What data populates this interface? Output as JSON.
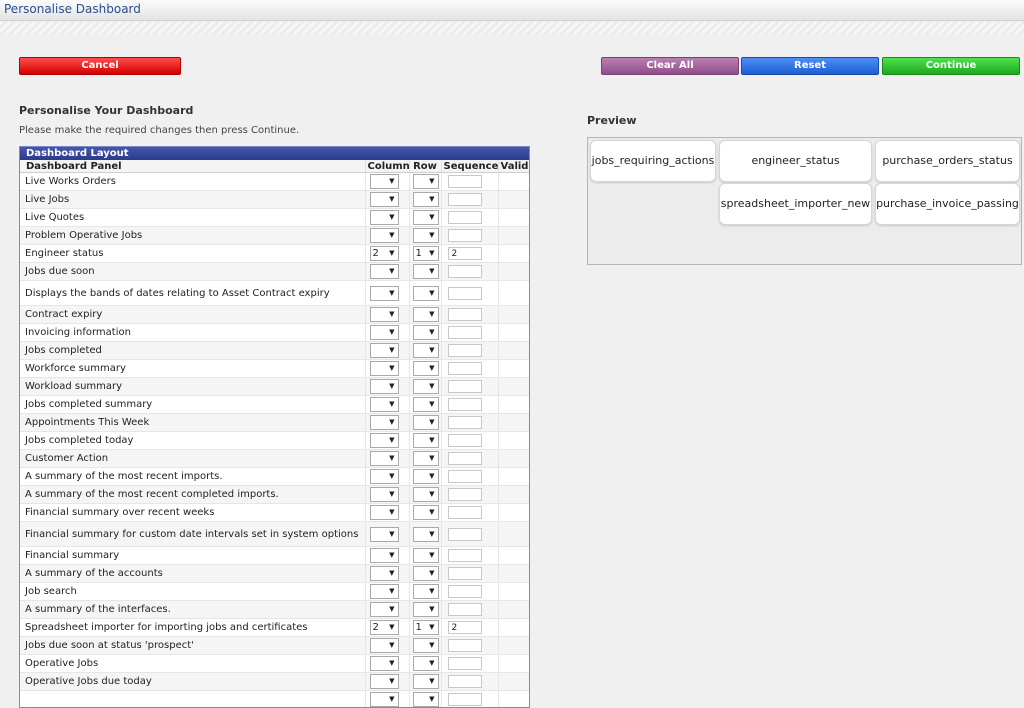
{
  "window": {
    "title": "Personalise Dashboard"
  },
  "toolbar": {
    "cancel_label": "Cancel",
    "clear_all_label": "Clear All",
    "reset_label": "Reset",
    "continue_label": "Continue"
  },
  "main": {
    "heading": "Personalise Your Dashboard",
    "instructions": "Please make the required changes then press Continue."
  },
  "layout": {
    "caption": "Dashboard Layout",
    "headers": {
      "panel": "Dashboard Panel",
      "column": "Column",
      "row": "Row",
      "sequence": "Sequence",
      "valid": "Valid"
    },
    "rows": [
      {
        "name": "Live Works Orders",
        "column": "",
        "row": "",
        "sequence": ""
      },
      {
        "name": "Live Jobs",
        "column": "",
        "row": "",
        "sequence": ""
      },
      {
        "name": "Live Quotes",
        "column": "",
        "row": "",
        "sequence": ""
      },
      {
        "name": "Problem Operative Jobs",
        "column": "",
        "row": "",
        "sequence": ""
      },
      {
        "name": "Engineer status",
        "column": "2",
        "row": "1",
        "sequence": "2"
      },
      {
        "name": "Jobs due soon",
        "column": "",
        "row": "",
        "sequence": ""
      },
      {
        "name": "Displays the bands of dates relating to Asset Contract expiry",
        "column": "",
        "row": "",
        "sequence": ""
      },
      {
        "name": "Contract expiry",
        "column": "",
        "row": "",
        "sequence": ""
      },
      {
        "name": "Invoicing information",
        "column": "",
        "row": "",
        "sequence": ""
      },
      {
        "name": "Jobs completed",
        "column": "",
        "row": "",
        "sequence": ""
      },
      {
        "name": "Workforce summary",
        "column": "",
        "row": "",
        "sequence": ""
      },
      {
        "name": "Workload summary",
        "column": "",
        "row": "",
        "sequence": ""
      },
      {
        "name": "Jobs completed summary",
        "column": "",
        "row": "",
        "sequence": ""
      },
      {
        "name": "Appointments This Week",
        "column": "",
        "row": "",
        "sequence": ""
      },
      {
        "name": "Jobs completed today",
        "column": "",
        "row": "",
        "sequence": ""
      },
      {
        "name": "Customer Action",
        "column": "",
        "row": "",
        "sequence": ""
      },
      {
        "name": "A summary of the most recent imports.",
        "column": "",
        "row": "",
        "sequence": ""
      },
      {
        "name": "A summary of the most recent completed imports.",
        "column": "",
        "row": "",
        "sequence": ""
      },
      {
        "name": "Financial summary over recent weeks",
        "column": "",
        "row": "",
        "sequence": ""
      },
      {
        "name": "Financial summary for custom date intervals set in system options",
        "column": "",
        "row": "",
        "sequence": ""
      },
      {
        "name": "Financial summary",
        "column": "",
        "row": "",
        "sequence": ""
      },
      {
        "name": "A summary of the accounts",
        "column": "",
        "row": "",
        "sequence": ""
      },
      {
        "name": "Job search",
        "column": "",
        "row": "",
        "sequence": ""
      },
      {
        "name": "A summary of the interfaces.",
        "column": "",
        "row": "",
        "sequence": ""
      },
      {
        "name": "Spreadsheet importer for importing jobs and certificates",
        "column": "2",
        "row": "1",
        "sequence": "2"
      },
      {
        "name": "Jobs due soon at status 'prospect'",
        "column": "",
        "row": "",
        "sequence": ""
      },
      {
        "name": "Operative Jobs",
        "column": "",
        "row": "",
        "sequence": ""
      },
      {
        "name": "Operative Jobs due today",
        "column": "",
        "row": "",
        "sequence": ""
      },
      {
        "name": "",
        "column": "",
        "row": "",
        "sequence": ""
      }
    ]
  },
  "preview": {
    "label": "Preview",
    "tiles": [
      "jobs_requiring_actions",
      "engineer_status",
      "purchase_orders_status",
      "spreadsheet_importer_new",
      "purchase_invoice_passing"
    ]
  },
  "icons": {
    "dropdown": "chevron-down-icon"
  }
}
